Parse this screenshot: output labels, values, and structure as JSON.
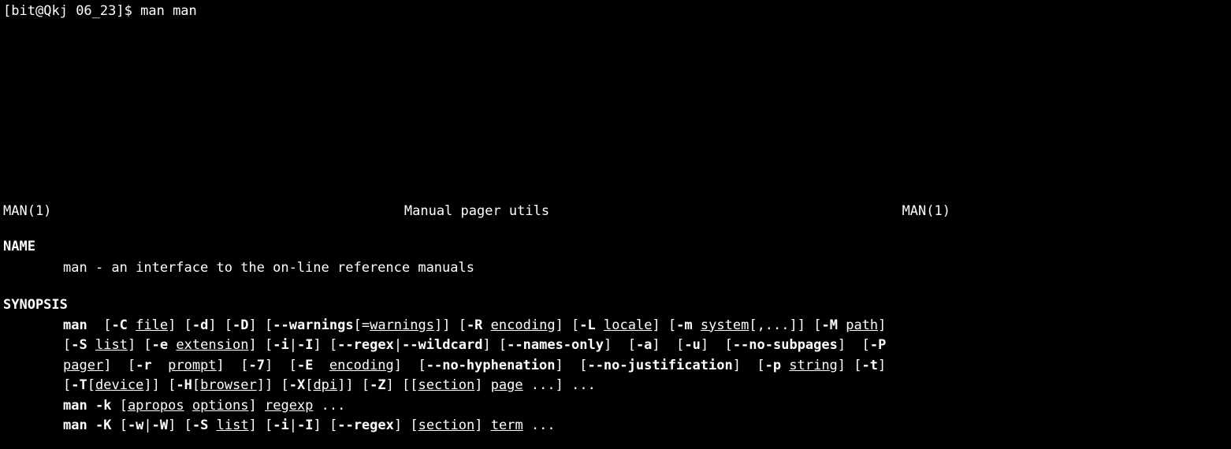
{
  "prompt": {
    "user": "bit",
    "host": "Qkj",
    "cwd": "06_23",
    "symbol": "$",
    "command": "man man"
  },
  "header": {
    "left": "MAN(1)",
    "center": "Manual pager utils",
    "right": "MAN(1)"
  },
  "sections": {
    "name_heading": "NAME",
    "name_line": "man - an interface to the on-line reference manuals",
    "synopsis_heading": "SYNOPSIS"
  },
  "synopsis": {
    "cmd": "man",
    "flags": {
      "C": "-C",
      "d": "-d",
      "D": "-D",
      "warnings": "--warnings",
      "R": "-R",
      "L": "-L",
      "m": "-m",
      "M": "-M",
      "S": "-S",
      "e": "-e",
      "i": "-i",
      "I": "-I",
      "regex": "--regex",
      "wildcard": "--wildcard",
      "names_only": "--names-only",
      "a": "-a",
      "u": "-u",
      "no_subpages": "--no-subpages",
      "P": "-P",
      "r": "-r",
      "seven": "-7",
      "E": "-E",
      "no_hyph": "--no-hyphenation",
      "no_just": "--no-justification",
      "p": "-p",
      "t": "-t",
      "T": "-T",
      "H": "-H",
      "X": "-X",
      "Z": "-Z",
      "k": "-k",
      "K": "-K",
      "w": "-w",
      "W": "-W"
    },
    "args": {
      "file": "file",
      "warnings": "warnings",
      "encoding": "encoding",
      "locale": "locale",
      "system": "system",
      "path": "path",
      "list": "list",
      "extension": "extension",
      "pager": "pager",
      "prompt": "prompt",
      "string": "string",
      "device": "device",
      "browser": "browser",
      "dpi": "dpi",
      "section": "section",
      "page": "page",
      "apropos": "apropos",
      "options": "options",
      "regexp": "regexp",
      "term": "term"
    },
    "ellipsis": "...",
    "comma_ellipsis": ",..."
  }
}
